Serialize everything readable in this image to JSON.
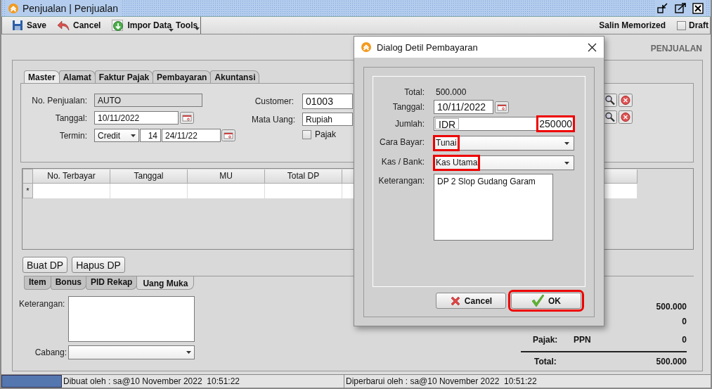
{
  "window": {
    "title": "Penjualan | Penjualan"
  },
  "toolbar": {
    "buttons": [
      {
        "label": "Save",
        "dropdown": false
      },
      {
        "label": "Cancel",
        "dropdown": false
      },
      {
        "label": "Impor Data",
        "dropdown": true
      },
      {
        "label": "Tools",
        "dropdown": true
      }
    ],
    "memorized": "Salin Memorized",
    "draft": {
      "label": "Draft",
      "checked": false
    }
  },
  "heading": "PENJUALAN",
  "master_tabs": [
    {
      "label": "Master",
      "selected": true
    },
    {
      "label": "Alamat",
      "selected": false
    },
    {
      "label": "Faktur Pajak",
      "selected": false
    },
    {
      "label": "Pembayaran",
      "selected": false
    },
    {
      "label": "Akuntansi",
      "selected": false
    }
  ],
  "master": {
    "no_penjualan": {
      "label": "No. Penjualan:",
      "value": "AUTO"
    },
    "tanggal": {
      "label": "Tanggal:",
      "value": "10/11/2022"
    },
    "termin": {
      "label": "Termin:",
      "value": "Credit",
      "days": "14",
      "due": "24/11/22"
    },
    "customer": {
      "label": "Customer:",
      "value": "01003"
    },
    "mata_uang": {
      "label": "Mata Uang:",
      "value": "Rupiah"
    },
    "pajak": {
      "label": "Pajak",
      "checked": false
    }
  },
  "dp_table": {
    "columns": [
      "No. Terbayar",
      "Tanggal",
      "MU",
      "Total DP"
    ],
    "new_row_marker": "*"
  },
  "dp_buttons": [
    "Buat DP",
    "Hapus DP"
  ],
  "detail_tabs": [
    {
      "label": "Item",
      "selected": false
    },
    {
      "label": "Bonus",
      "selected": false
    },
    {
      "label": "PID Rekap",
      "selected": false
    },
    {
      "label": "Uang Muka",
      "selected": true
    }
  ],
  "keterangan": {
    "label": "Keterangan:"
  },
  "cabang": {
    "label": "Cabang:"
  },
  "totals": [
    {
      "kind": "amount",
      "value": "500.000"
    },
    {
      "kind": "amount",
      "value": "0"
    },
    {
      "kind": "tax",
      "label": "Pajak:",
      "tax": "PPN",
      "value": "0"
    },
    {
      "kind": "grand",
      "label": "Total:",
      "value": "500.000"
    }
  ],
  "progress": {
    "level": 1
  },
  "status_bar": [
    "Dibuat oleh : sa@10 November 2022  10:51:22",
    "Diperbarui oleh : sa@10 November 2022  10:51:22"
  ],
  "dialog": {
    "title": "Dialog Detil Pembayaran",
    "total": {
      "label": "Total:",
      "value": "500.000"
    },
    "tanggal": {
      "label": "Tanggal:",
      "value": "10/11/2022"
    },
    "jumlah": {
      "label": "Jumlah:",
      "currency": "IDR",
      "value": "250000",
      "highlighted": true
    },
    "cara_bayar": {
      "label": "Cara Bayar:",
      "value": "Tunai",
      "highlighted": true
    },
    "kas_bank": {
      "label": "Kas / Bank:",
      "value": "Kas Utama",
      "highlighted": true
    },
    "keterangan": {
      "label": "Keterangan:",
      "value": "DP 2 Slop Gudang Garam"
    },
    "buttons": [
      {
        "label": "Cancel",
        "kind": "cancel",
        "highlighted": false
      },
      {
        "label": "OK",
        "kind": "ok",
        "highlighted": true
      }
    ]
  }
}
